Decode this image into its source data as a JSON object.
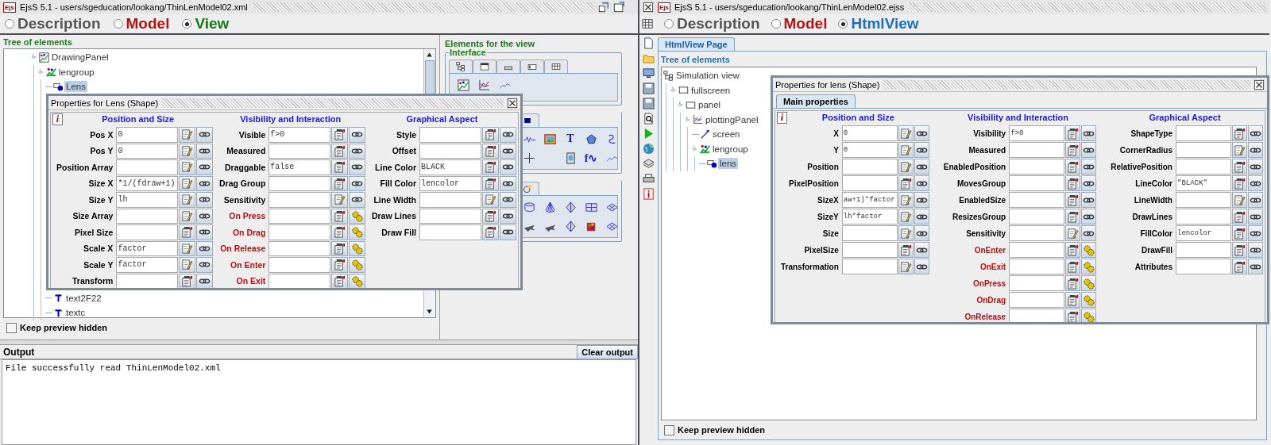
{
  "left_window": {
    "logo": "Ejs",
    "title": "EjsS 5.1 - users/sgeducation/lookang/ThinLenModel02.xml",
    "modes": [
      {
        "label": "Description",
        "selected": false,
        "color": "#555555"
      },
      {
        "label": "Model",
        "selected": false,
        "color": "#b01515"
      },
      {
        "label": "View",
        "selected": true,
        "color": "#1a7a1a"
      }
    ],
    "tree_panel": {
      "title": "Tree of elements",
      "tree": [
        {
          "label": "DrawingPanel",
          "kind": "panel",
          "selected": false,
          "children": [
            {
              "label": "lengroup",
              "kind": "group",
              "selected": false,
              "children": [
                {
                  "label": "Lens",
                  "kind": "shape",
                  "selected": true
                },
                {
                  "label": "text2F22",
                  "kind": "text",
                  "selected": false
                },
                {
                  "label": "textc",
                  "kind": "text",
                  "selected": false
                }
              ]
            }
          ]
        }
      ]
    },
    "keep_preview_hidden": {
      "label": "Keep preview hidden",
      "checked": false
    },
    "elements_panel": {
      "title": "Elements for the view",
      "group_title": "Interface",
      "glyphs": [
        "T",
        "f∿"
      ]
    },
    "output": {
      "title": "Output",
      "clear_button": "Clear output",
      "text": "File successfully read ThinLenModel02.xml"
    },
    "properties_dialog": {
      "title": "Properties for Lens (Shape)",
      "info": "i",
      "sections": [
        {
          "title": "Position and Size",
          "properties": [
            {
              "label": "Pos X",
              "value": "0",
              "kind": "expression"
            },
            {
              "label": "Pos Y",
              "value": "0",
              "kind": "expression"
            },
            {
              "label": "Position Array",
              "kind": "expression"
            },
            {
              "label": "Size X",
              "value": "*1/(fdraw+1)",
              "kind": "expression"
            },
            {
              "label": "Size Y",
              "value": "lh",
              "kind": "expression"
            },
            {
              "label": "Size Array",
              "kind": "expression"
            },
            {
              "label": "Pixel Size",
              "kind": "choice"
            },
            {
              "label": "Scale X",
              "value": "factor",
              "kind": "expression"
            },
            {
              "label": "Scale Y",
              "value": "factor",
              "kind": "expression"
            },
            {
              "label": "Transform",
              "kind": "choice"
            }
          ]
        },
        {
          "title": "Visibility and Interaction",
          "properties": [
            {
              "label": "Visible",
              "value": "f>0",
              "kind": "choice"
            },
            {
              "label": "Measured",
              "kind": "choice"
            },
            {
              "label": "Draggable",
              "value": "false",
              "kind": "choice"
            },
            {
              "label": "Drag Group",
              "kind": "choice"
            },
            {
              "label": "Sensitivity",
              "kind": "expression"
            },
            {
              "label": "On Press",
              "kind": "event"
            },
            {
              "label": "On Drag",
              "kind": "event"
            },
            {
              "label": "On Release",
              "kind": "event"
            },
            {
              "label": "On Enter",
              "kind": "event"
            },
            {
              "label": "On Exit",
              "kind": "event"
            }
          ]
        },
        {
          "title": "Graphical Aspect",
          "properties": [
            {
              "label": "Style",
              "kind": "choice"
            },
            {
              "label": "Offset",
              "kind": "choice"
            },
            {
              "label": "Line Color",
              "value": "BLACK",
              "kind": "choice"
            },
            {
              "label": "Fill Color",
              "value": "lencolor",
              "kind": "choice"
            },
            {
              "label": "Line Width",
              "kind": "expression"
            },
            {
              "label": "Draw Lines",
              "kind": "choice"
            },
            {
              "label": "Draw Fill",
              "kind": "choice"
            }
          ]
        }
      ]
    }
  },
  "right_window": {
    "logo": "Ejs",
    "title": "EjsS 5.1 - users/sgeducation/lookang/ThinLenModel02.ejss",
    "modes": [
      {
        "label": "Description",
        "selected": false,
        "color": "#555555"
      },
      {
        "label": "Model",
        "selected": false,
        "color": "#b01515"
      },
      {
        "label": "HtmlView",
        "selected": true,
        "color": "#1a6fc0"
      }
    ],
    "page_tab": "HtmlView Page",
    "tree_panel": {
      "title": "Tree of elements",
      "tree": [
        {
          "label": "Simulation view",
          "kind": "view",
          "selected": false,
          "children": [
            {
              "label": "fullscreen",
              "kind": "frame",
              "selected": false,
              "children": [
                {
                  "label": "panel",
                  "kind": "frame",
                  "selected": false,
                  "children": [
                    {
                      "label": "plottingPanel",
                      "kind": "plot",
                      "selected": false,
                      "children": [
                        {
                          "label": "screen",
                          "kind": "line",
                          "selected": false
                        },
                        {
                          "label": "lengroup",
                          "kind": "group",
                          "selected": false,
                          "children": [
                            {
                              "label": "lens",
                              "kind": "shape",
                              "selected": true
                            }
                          ]
                        }
                      ]
                    }
                  ]
                }
              ]
            }
          ]
        }
      ]
    },
    "keep_preview_hidden": {
      "label": "Keep preview hidden",
      "checked": false
    },
    "properties_dialog": {
      "title": "Properties for lens (Shape)",
      "tab": "Main properties",
      "info": "i",
      "sections": [
        {
          "title": "Position and Size",
          "properties": [
            {
              "label": "X",
              "value": "0",
              "kind": "expression"
            },
            {
              "label": "Y",
              "value": "0",
              "kind": "expression"
            },
            {
              "label": "Position",
              "kind": "expression"
            },
            {
              "label": "PixelPosition",
              "kind": "choice"
            },
            {
              "label": "SizeX",
              "value": "aw+1)*factor",
              "kind": "expression"
            },
            {
              "label": "SizeY",
              "value": "lh*factor",
              "kind": "expression"
            },
            {
              "label": "Size",
              "kind": "expression"
            },
            {
              "label": "PixelSize",
              "kind": "choice"
            },
            {
              "label": "Transformation",
              "kind": "expression"
            }
          ]
        },
        {
          "title": "Visibility and Interaction",
          "properties": [
            {
              "label": "Visibility",
              "value": "f>0",
              "kind": "choice"
            },
            {
              "label": "Measured",
              "kind": "choice"
            },
            {
              "label": "EnabledPosition",
              "kind": "choice"
            },
            {
              "label": "MovesGroup",
              "kind": "choice"
            },
            {
              "label": "EnabledSize",
              "kind": "choice"
            },
            {
              "label": "ResizesGroup",
              "kind": "choice"
            },
            {
              "label": "Sensitivity",
              "kind": "expression"
            },
            {
              "label": "OnEnter",
              "kind": "event"
            },
            {
              "label": "OnExit",
              "kind": "event"
            },
            {
              "label": "OnPress",
              "kind": "event"
            },
            {
              "label": "OnDrag",
              "kind": "event"
            },
            {
              "label": "OnRelease",
              "kind": "event"
            }
          ]
        },
        {
          "title": "Graphical Aspect",
          "properties": [
            {
              "label": "ShapeType",
              "kind": "choice"
            },
            {
              "label": "CornerRadius",
              "kind": "expression"
            },
            {
              "label": "RelativePosition",
              "kind": "choice"
            },
            {
              "label": "LineColor",
              "value": "\"BLACK\"",
              "kind": "choice"
            },
            {
              "label": "LineWidth",
              "kind": "expression"
            },
            {
              "label": "DrawLines",
              "kind": "choice"
            },
            {
              "label": "FillColor",
              "value": "lencolor",
              "kind": "choice"
            },
            {
              "label": "DrawFill",
              "kind": "choice"
            },
            {
              "label": "Attributes",
              "kind": "choice"
            }
          ]
        }
      ]
    }
  }
}
